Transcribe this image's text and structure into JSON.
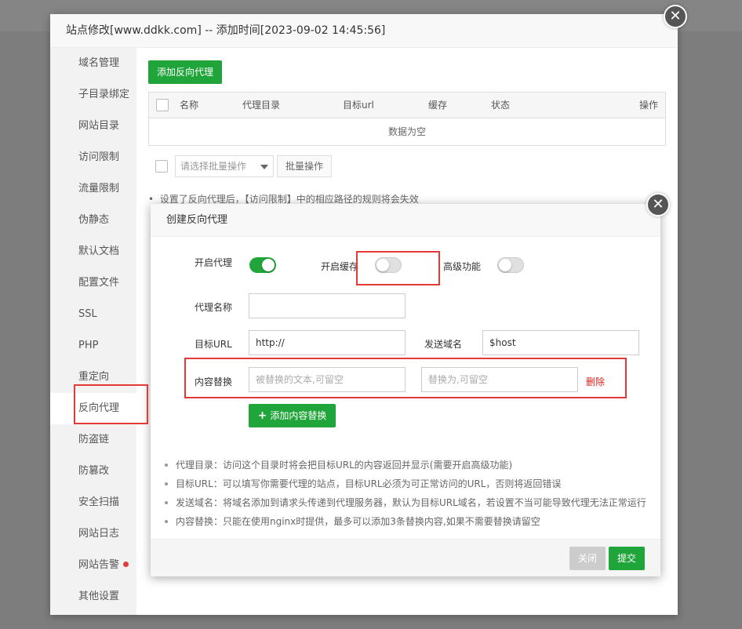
{
  "window": {
    "title": "站点修改[www.ddkk.com] -- 添加时间[2023-09-02 14:45:56]",
    "close_glyph": "✕"
  },
  "sidebar": {
    "items": [
      {
        "label": "域名管理"
      },
      {
        "label": "子目录绑定"
      },
      {
        "label": "网站目录"
      },
      {
        "label": "访问限制"
      },
      {
        "label": "流量限制"
      },
      {
        "label": "伪静态"
      },
      {
        "label": "默认文档"
      },
      {
        "label": "配置文件"
      },
      {
        "label": "SSL"
      },
      {
        "label": "PHP"
      },
      {
        "label": "重定向"
      },
      {
        "label": "反向代理",
        "active": true
      },
      {
        "label": "防盗链"
      },
      {
        "label": "防篡改"
      },
      {
        "label": "安全扫描"
      },
      {
        "label": "网站日志"
      },
      {
        "label": "网站告警",
        "dot": true
      },
      {
        "label": "其他设置"
      }
    ]
  },
  "proxy_list": {
    "add_button": "添加反向代理",
    "columns": [
      "名称",
      "代理目录",
      "目标url",
      "缓存",
      "状态",
      "操作"
    ],
    "empty_text": "数据为空",
    "batch_select_placeholder": "请选择批量操作",
    "batch_button": "批量操作",
    "tip": "设置了反向代理后，【访问限制】中的相应路径的规则将会失效"
  },
  "create_dialog": {
    "title": "创建反向代理",
    "enable_proxy_label": "开启代理",
    "enable_proxy": true,
    "enable_cache_label": "开启缓存",
    "enable_cache": false,
    "advanced_label": "高级功能",
    "advanced": false,
    "proxy_name_label": "代理名称",
    "proxy_name_value": "",
    "target_url_label": "目标URL",
    "target_url_value": "http://",
    "send_domain_label": "发送域名",
    "send_domain_value": "$host",
    "replace_label": "内容替换",
    "replace_from_placeholder": "被替换的文本,可留空",
    "replace_to_placeholder": "替换为,可留空",
    "delete_link": "删除",
    "add_replace_button": "添加内容替换",
    "notes": [
      "代理目录：访问这个目录时将会把目标URL的内容返回并显示(需要开启高级功能)",
      "目标URL：可以填写你需要代理的站点，目标URL必须为可正常访问的URL，否则将返回错误",
      "发送域名：将域名添加到请求头传递到代理服务器，默认为目标URL域名，若设置不当可能导致代理无法正常运行",
      "内容替换：只能在使用nginx时提供，最多可以添加3条替换内容,如果不需要替换请留空"
    ],
    "close_button": "关闭",
    "submit_button": "提交"
  },
  "colors": {
    "accent": "#20a53a",
    "highlight": "#e53935",
    "delete": "#e02020"
  }
}
